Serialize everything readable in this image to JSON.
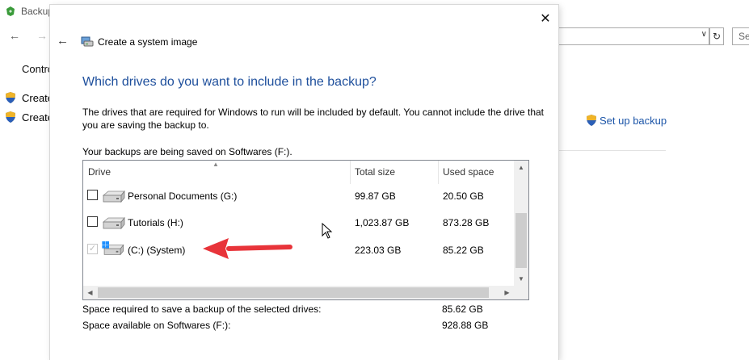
{
  "background_window": {
    "title": "Backup",
    "nav": {
      "back_icon": "←",
      "forward_icon": "→"
    },
    "search_placeholder": "Se",
    "control_panel_link": "Contro",
    "sidebar_items": [
      {
        "label": "Create",
        "icon": "shield-icon"
      },
      {
        "label": "Create",
        "icon": "shield-icon"
      }
    ],
    "setup_backup_link": "Set up backup"
  },
  "dialog": {
    "close_icon": "✕",
    "back_icon": "←",
    "title": "Create a system image",
    "heading": "Which drives do you want to include in the backup?",
    "description": "The drives that are required for Windows to run will be included by default. You cannot include the drive that you are saving the backup to.",
    "saved_on": "Your backups are being saved on Softwares (F:).",
    "columns": {
      "drive": "Drive",
      "total_size": "Total size",
      "used_space": "Used space"
    },
    "drives": [
      {
        "name": "Personal Documents (G:)",
        "total": "99.87 GB",
        "used": "20.50 GB",
        "checked": false,
        "disabled": false,
        "windows_logo": false
      },
      {
        "name": "Tutorials (H:)",
        "total": "1,023.87 GB",
        "used": "873.28 GB",
        "checked": false,
        "disabled": false,
        "windows_logo": false
      },
      {
        "name": "(C:) (System)",
        "total": "223.03 GB",
        "used": "85.22 GB",
        "checked": true,
        "disabled": true,
        "windows_logo": true
      }
    ],
    "space_required_label": "Space required to save a backup of the selected drives:",
    "space_required_value": "85.62 GB",
    "space_available_label": "Space available on Softwares (F:):",
    "space_available_value": "928.88 GB"
  },
  "colors": {
    "heading": "#1e4f9c",
    "link": "#1c55a8",
    "annotation_arrow": "#e8343a"
  }
}
